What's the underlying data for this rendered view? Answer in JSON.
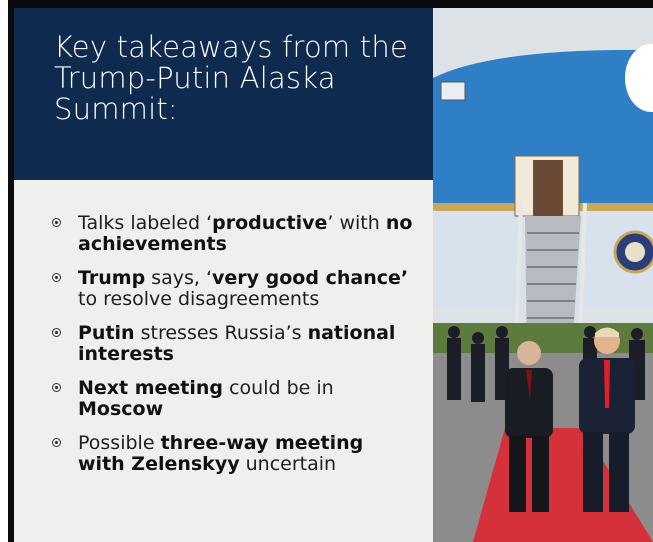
{
  "header": {
    "title": "Key takeaways from the Trump-Putin Alaska Summit:"
  },
  "bullets": [
    {
      "parts": [
        {
          "t": "Talks labeled ‘"
        },
        {
          "t": "productive",
          "b": true
        },
        {
          "t": "’ with "
        },
        {
          "t": "no achievements",
          "b": true
        }
      ]
    },
    {
      "parts": [
        {
          "t": "Trump",
          "b": true
        },
        {
          "t": " says, ‘"
        },
        {
          "t": "very good chance’",
          "b": true
        },
        {
          "t": " to resolve disagreements"
        }
      ]
    },
    {
      "parts": [
        {
          "t": "Putin",
          "b": true
        },
        {
          "t": " stresses Russia’s "
        },
        {
          "t": "national interests",
          "b": true
        }
      ]
    },
    {
      "parts": [
        {
          "t": "Next meeting",
          "b": true
        },
        {
          "t": " could be in "
        },
        {
          "t": "Moscow",
          "b": true
        }
      ]
    },
    {
      "parts": [
        {
          "t": "Possible "
        },
        {
          "t": "three-way meeting with Zelenskyy",
          "b": true
        },
        {
          "t": " uncertain"
        }
      ]
    }
  ],
  "photo": {
    "icon": "air-force-one-summit-photo",
    "colors": {
      "sky": "#dfe3e8",
      "plane_blue": "#2e7ec4",
      "carpet": "#d8323a",
      "tarmac": "#8c8d8c"
    }
  }
}
